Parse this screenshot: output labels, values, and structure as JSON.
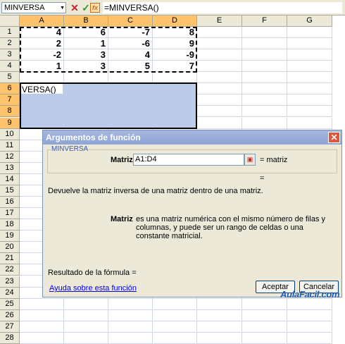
{
  "formula_bar": {
    "name_box": "MINVERSA",
    "formula": "=MINVERSA()",
    "cancel_icon": "cross-icon",
    "enter_icon": "check-icon",
    "fx_icon": "function-icon"
  },
  "columns": [
    "A",
    "B",
    "C",
    "D",
    "E",
    "F",
    "G"
  ],
  "rows": [
    "1",
    "2",
    "3",
    "4",
    "5",
    "6",
    "7",
    "8",
    "9",
    "10",
    "11",
    "12",
    "13",
    "14",
    "15",
    "16",
    "17",
    "18",
    "19",
    "20",
    "21",
    "22",
    "23",
    "24",
    "25",
    "26",
    "27",
    "28"
  ],
  "cells": [
    [
      "4",
      "6",
      "-7",
      "8"
    ],
    [
      "2",
      "1",
      "-6",
      "9"
    ],
    [
      "-2",
      "3",
      "4",
      "-9"
    ],
    [
      "1",
      "3",
      "5",
      "7"
    ]
  ],
  "active_cell_text": "VERSA()",
  "dialog": {
    "title": "Argumentos de función",
    "function_name": "MINVERSA",
    "arg_label": "Matriz",
    "arg_value": "A1:D4",
    "arg_result": "= matriz",
    "equals_sign": "=",
    "description": "Devuelve la matriz inversa de una matriz dentro de una matriz.",
    "help_arg_name": "Matriz",
    "help_arg_text": "es una matriz numérica con el mismo número de filas y columnas, y puede ser un rango de celdas o una constante matricial.",
    "result_label": "Resultado de la fórmula =",
    "help_link": "Ayuda sobre esta función",
    "ok_label": "Aceptar",
    "cancel_label": "Cancelar"
  },
  "watermark": "AulaFacil.com"
}
